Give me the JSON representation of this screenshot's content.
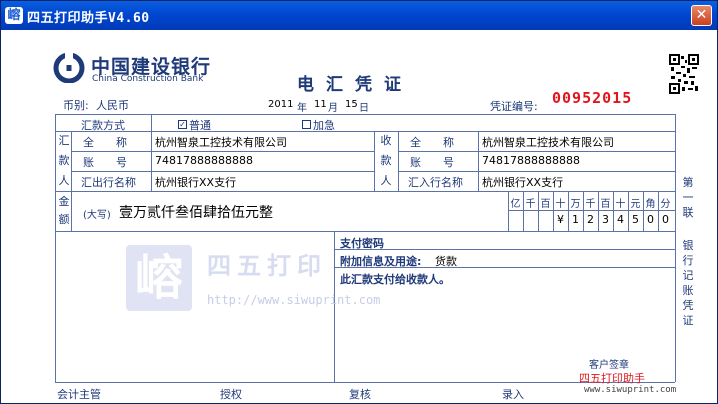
{
  "window": {
    "title": "四五打印助手V4.60",
    "icon_glyph": "嵱",
    "close_glyph": "✕"
  },
  "bank": {
    "name_cn": "中国建设银行",
    "name_en": "China Construction Bank"
  },
  "form": {
    "title": "电汇凭证",
    "currency_label": "币别:",
    "currency_value": "人民币",
    "year": "2011",
    "year_unit": "年",
    "month": "11",
    "month_unit": "月",
    "day": "15",
    "day_unit": "日",
    "voucher_label": "凭证编号:",
    "voucher_no": "00952015",
    "remit_method_label": "汇款方式",
    "method_normal": "普通",
    "method_urgent": "加急",
    "normal_checked_glyph": "✓",
    "payer_vertical": [
      "汇",
      "款",
      "人"
    ],
    "payee_vertical": [
      "收",
      "款",
      "人"
    ],
    "amount_vertical": [
      "金",
      "额"
    ],
    "full_name_label": "全　　称",
    "account_label": "账　　号",
    "payer_bank_label": "汇出行名称",
    "payee_bank_label": "汇入行名称",
    "payer_full_name": "杭州智泉工控技术有限公司",
    "payer_account": "74817888888888",
    "payer_bank": "杭州银行XX支行",
    "payee_full_name": "杭州智泉工控技术有限公司",
    "payee_account": "74817888888888",
    "payee_bank": "杭州银行XX支行",
    "amount_upper_label": "(大写)",
    "amount_upper_value": "壹万贰仟叁佰肆拾伍元整",
    "digit_headers": [
      "亿",
      "千",
      "百",
      "十",
      "万",
      "千",
      "百",
      "十",
      "元",
      "角",
      "分"
    ],
    "digit_values": [
      "",
      "",
      "",
      "¥",
      "1",
      "2",
      "3",
      "4",
      "5",
      "0",
      "0"
    ],
    "password_label": "支付密码",
    "extra_info_label": "附加信息及用途:",
    "extra_info_value": "货款",
    "pay_note": "此汇款支付给收款人。",
    "customer_sign": "客户签章",
    "side_copy": [
      "第",
      "一",
      "联",
      "",
      "银",
      "行",
      "记",
      "账",
      "凭",
      "证"
    ],
    "footer_accountant": "会计主管",
    "footer_authorize": "授权",
    "footer_review": "复核",
    "footer_entry": "录入"
  },
  "watermark": {
    "logo_glyph": "嵱",
    "name": "四五打印",
    "url": "http://www.siwuprint.com"
  },
  "footer": {
    "brand": "四五打印助手",
    "url": "www.siwuprint.com"
  },
  "colors": {
    "title_bar": "#0047d0",
    "form_ink": "#1f3a78",
    "voucher_red": "#e0161e"
  }
}
